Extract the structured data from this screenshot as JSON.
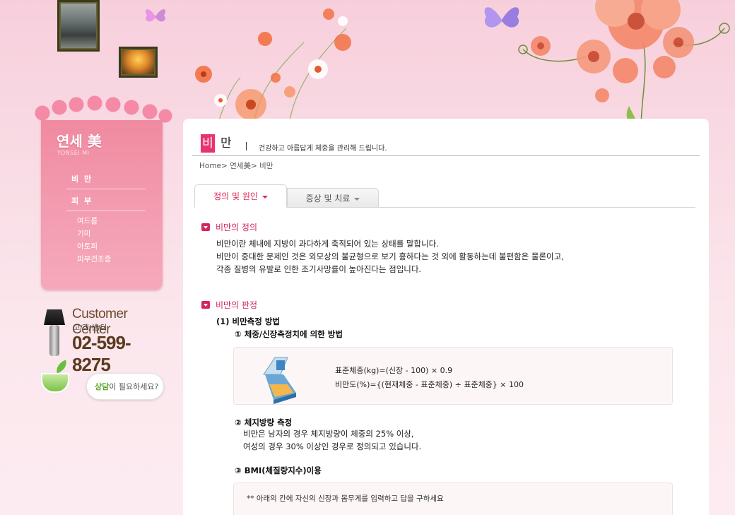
{
  "sidebar": {
    "brand_title": "연세 美",
    "brand_sub": "YONSEI MI",
    "menu": [
      {
        "label": "비 만"
      },
      {
        "label": "피 부"
      }
    ],
    "submenu": [
      {
        "label": "여드름"
      },
      {
        "label": "기미"
      },
      {
        "label": "아토피"
      },
      {
        "label": "피부건조증"
      }
    ],
    "customer_center": {
      "title": "Customer Center",
      "kor": "고/객/센/터",
      "phone": "02-599-8275"
    },
    "consult": {
      "accent": "상담",
      "rest": "이 필요하세요?"
    }
  },
  "page": {
    "title_char1": "비",
    "title_char2": "만",
    "description": "건강하고 아름답게 체중을 관리해 드립니다.",
    "breadcrumb": "Home> 연세美> 비만"
  },
  "tabs": [
    {
      "label": "정의 및 원인",
      "active": true
    },
    {
      "label": "증상 및 치료",
      "active": false
    }
  ],
  "section1": {
    "heading": "비만의 정의",
    "lines": [
      "비만이란 체내에 지방이 과다하게 축적되어 있는 상태를 말합니다.",
      "비만이 중대한 문제인 것은 외모상의 불균형으로 보기 흉하다는 것 외에 활동하는데 불편함은 물론이고,",
      "각종 질병의 유발로 인한 조기사망률이 높아진다는 점입니다."
    ]
  },
  "section2": {
    "heading": "비만의 판정",
    "sub1": "(1) 비만측정 방법",
    "method1": "① 체중/신장측정치에 의한 방법",
    "formula1": "표준체중(kg)=(신장 - 100) × 0.9",
    "formula2": "비만도(%)={(현재체중 - 표준체중) ÷ 표준체중} × 100",
    "method2": "② 체지방량 측정",
    "method2_lines": [
      "비만은 남자의 경우 체지방량이 체중의 25% 이상,",
      "여성의 경우 30% 이상인 경우로 정의되고 있습니다."
    ],
    "method3": "③ BMI(체질량지수)이용",
    "bmi_note": "** 아래의 칸에 자신의 신장과 몸무게를 입력하고 답을 구하세요"
  },
  "colors": {
    "accent": "#e8336d",
    "heading": "#d4265a",
    "sidebar": "#f08aa0"
  }
}
